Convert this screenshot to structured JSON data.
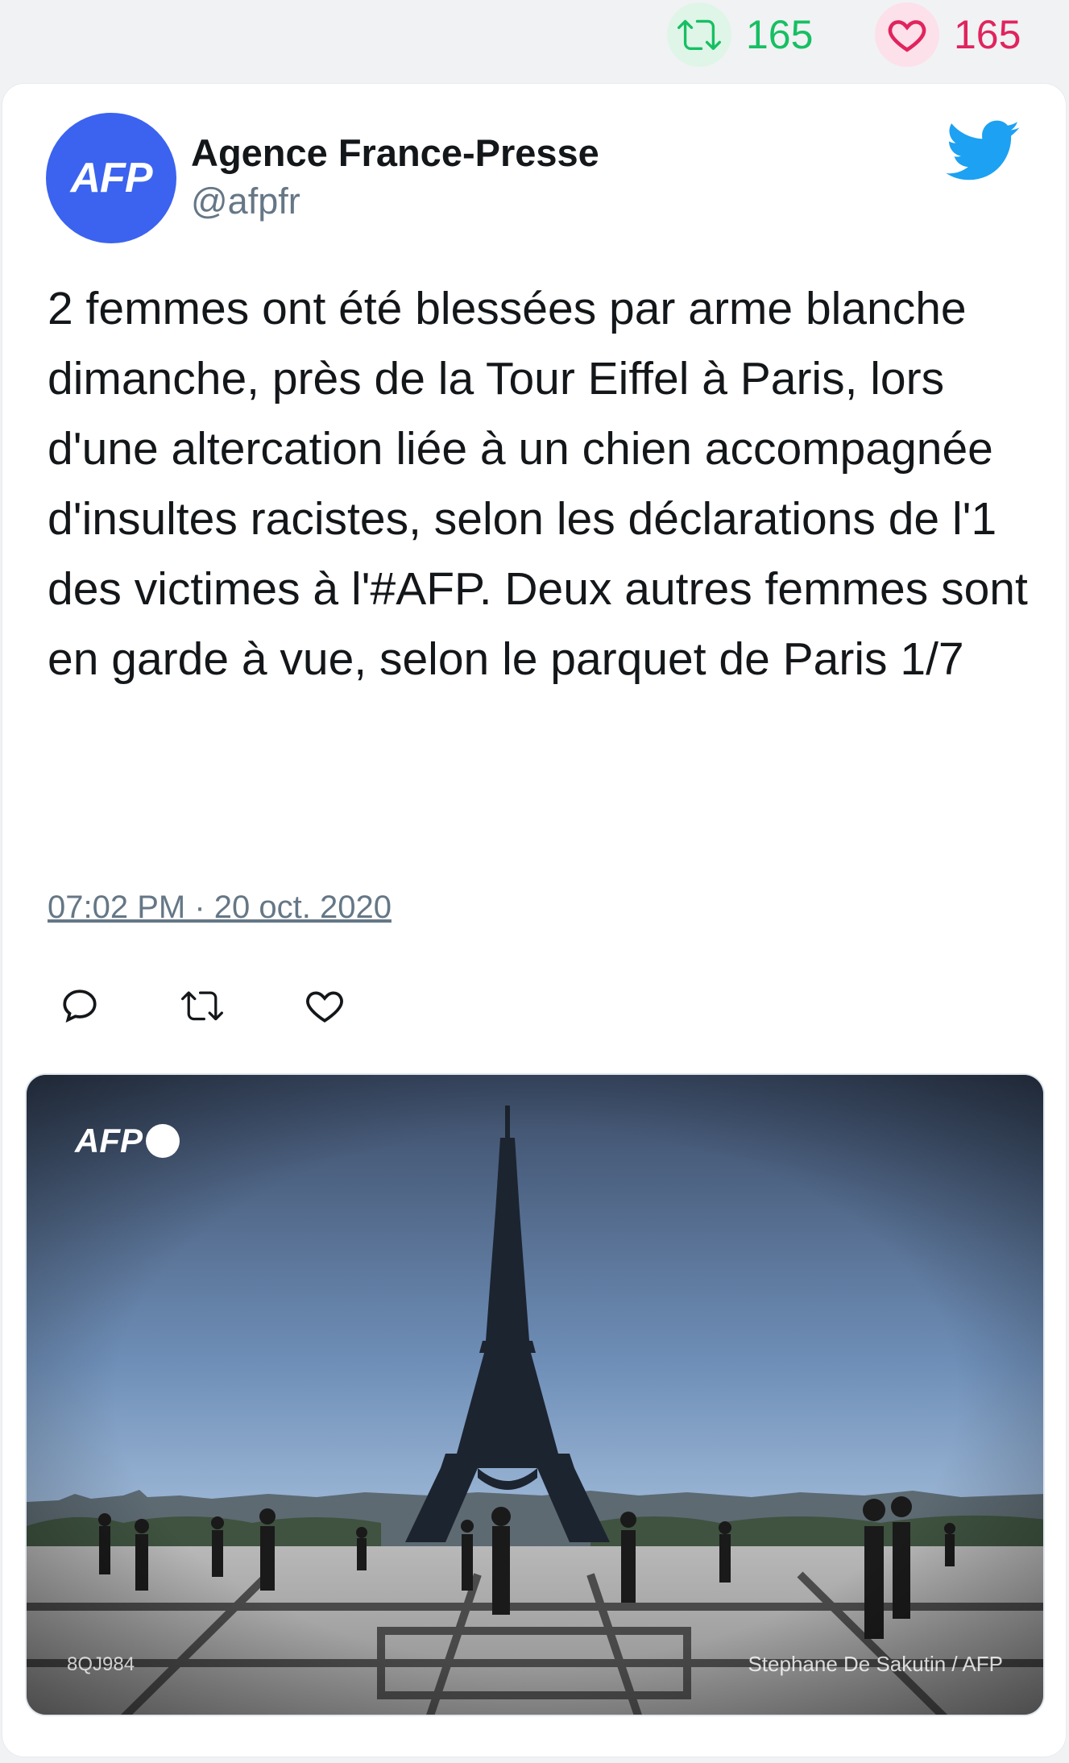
{
  "stats": {
    "retweets": "165",
    "likes": "165",
    "retweet_icon": "retweet-icon",
    "like_icon": "heart-icon",
    "retweet_color": "#17bf63",
    "like_color": "#e0245e"
  },
  "tweet": {
    "author_name": "Agence France-Presse",
    "author_handle": "@afpfr",
    "avatar_text": "AFP",
    "avatar_color": "#3b63ef",
    "text": "2 femmes ont été blessées par arme blanche dimanche, près de la Tour Eiffel à Paris, lors d'une altercation liée à un chien accompagnée d'insultes racistes, selon les déclarations de l'1 des victimes à l'#AFP. Deux autres femmes sont en garde à vue, selon le parquet de Paris 1/7",
    "timestamp": "07:02 PM · 20 oct. 2020",
    "platform_icon": "twitter-bird-icon",
    "actions": [
      {
        "icon": "reply-icon"
      },
      {
        "icon": "retweet-icon"
      },
      {
        "icon": "like-icon"
      }
    ]
  },
  "media": {
    "logo_text": "AFP",
    "code": "8QJ984",
    "credit": "Stephane De Sakutin / AFP",
    "description_icon": "eiffel-tower-photo"
  }
}
